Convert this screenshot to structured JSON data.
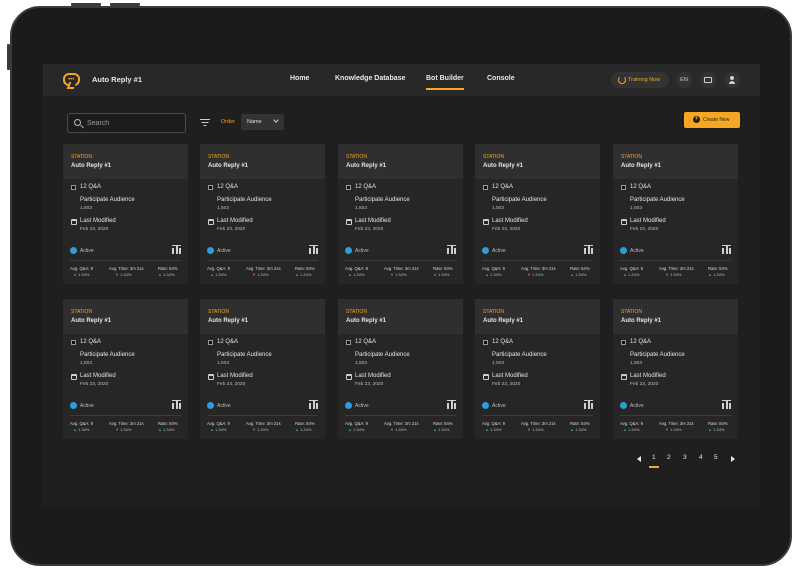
{
  "app": {
    "title": "Auto Reply #1"
  },
  "nav": [
    {
      "label": "Home",
      "active": false
    },
    {
      "label": "Knowledge Database",
      "active": false
    },
    {
      "label": "Bot Builder",
      "active": true
    },
    {
      "label": "Console",
      "active": false
    }
  ],
  "header": {
    "training_label": "Training Now",
    "language": "EN"
  },
  "toolbar": {
    "search_placeholder": "Search",
    "order_label": "Order",
    "order_value": "Name",
    "create_label": "Create New"
  },
  "card_template": {
    "tag": "STATION",
    "name": "Auto Reply #1",
    "qa": "12 Q&A",
    "audience_label": "Participate Audience",
    "audience_value": "1,503",
    "modified_label": "Last Modified",
    "modified_value": "Feb 23, 2020",
    "status": "Active",
    "stats": [
      {
        "label": "Avg. Q&A: 9",
        "trend": "up",
        "change": "1.34%"
      },
      {
        "label": "Avg. Time: 3m 21s",
        "trend": "down",
        "change": "1.34%"
      },
      {
        "label": "Rate: 84%",
        "trend": "up",
        "change": "1.34%"
      }
    ]
  },
  "cards": [
    {
      "tag": "STATION",
      "name": "Auto Reply #1",
      "qa": "12 Q&A",
      "audience_label": "Participate Audience",
      "audience_value": "1,503",
      "modified_label": "Last Modified",
      "modified_value": "Feb 23, 2020",
      "status": "Active",
      "s1": "Avg. Q&A: 9",
      "s1v": "1.34%",
      "s2": "Avg. Time: 3m 21s",
      "s2v": "1.34%",
      "s3": "Rate: 84%",
      "s3v": "1.34%"
    },
    {
      "tag": "STATION",
      "name": "Auto Reply #1",
      "qa": "12 Q&A",
      "audience_label": "Participate Audience",
      "audience_value": "1,503",
      "modified_label": "Last Modified",
      "modified_value": "Feb 23, 2020",
      "status": "Active",
      "s1": "Avg. Q&A: 9",
      "s1v": "1.34%",
      "s2": "Avg. Time: 3m 21s",
      "s2v": "1.34%",
      "s3": "Rate: 84%",
      "s3v": "1.34%"
    },
    {
      "tag": "STATION",
      "name": "Auto Reply #1",
      "qa": "12 Q&A",
      "audience_label": "Participate Audience",
      "audience_value": "1,503",
      "modified_label": "Last Modified",
      "modified_value": "Feb 23, 2020",
      "status": "Active",
      "s1": "Avg. Q&A: 9",
      "s1v": "1.34%",
      "s2": "Avg. Time: 3m 21s",
      "s2v": "1.34%",
      "s3": "Rate: 84%",
      "s3v": "1.34%"
    },
    {
      "tag": "STATION",
      "name": "Auto Reply #1",
      "qa": "12 Q&A",
      "audience_label": "Participate Audience",
      "audience_value": "1,503",
      "modified_label": "Last Modified",
      "modified_value": "Feb 23, 2020",
      "status": "Active",
      "s1": "Avg. Q&A: 9",
      "s1v": "1.34%",
      "s2": "Avg. Time: 3m 21s",
      "s2v": "1.34%",
      "s3": "Rate: 84%",
      "s3v": "1.34%"
    },
    {
      "tag": "STATION",
      "name": "Auto Reply #1",
      "qa": "12 Q&A",
      "audience_label": "Participate Audience",
      "audience_value": "1,503",
      "modified_label": "Last Modified",
      "modified_value": "Feb 23, 2020",
      "status": "Active",
      "s1": "Avg. Q&A: 9",
      "s1v": "1.34%",
      "s2": "Avg. Time: 3m 21s",
      "s2v": "1.34%",
      "s3": "Rate: 84%",
      "s3v": "1.34%"
    },
    {
      "tag": "STATION",
      "name": "Auto Reply #1",
      "qa": "12 Q&A",
      "audience_label": "Participate Audience",
      "audience_value": "1,503",
      "modified_label": "Last Modified",
      "modified_value": "Feb 23, 2020",
      "status": "Active",
      "s1": "Avg. Q&A: 9",
      "s1v": "1.34%",
      "s2": "Avg. Time: 3m 21s",
      "s2v": "1.34%",
      "s3": "Rate: 84%",
      "s3v": "1.34%"
    },
    {
      "tag": "STATION",
      "name": "Auto Reply #1",
      "qa": "12 Q&A",
      "audience_label": "Participate Audience",
      "audience_value": "1,503",
      "modified_label": "Last Modified",
      "modified_value": "Feb 23, 2020",
      "status": "Active",
      "s1": "Avg. Q&A: 9",
      "s1v": "1.34%",
      "s2": "Avg. Time: 3m 21s",
      "s2v": "1.34%",
      "s3": "Rate: 84%",
      "s3v": "1.34%"
    },
    {
      "tag": "STATION",
      "name": "Auto Reply #1",
      "qa": "12 Q&A",
      "audience_label": "Participate Audience",
      "audience_value": "1,503",
      "modified_label": "Last Modified",
      "modified_value": "Feb 23, 2020",
      "status": "Active",
      "s1": "Avg. Q&A: 9",
      "s1v": "1.34%",
      "s2": "Avg. Time: 3m 21s",
      "s2v": "1.34%",
      "s3": "Rate: 84%",
      "s3v": "1.34%"
    },
    {
      "tag": "STATION",
      "name": "Auto Reply #1",
      "qa": "12 Q&A",
      "audience_label": "Participate Audience",
      "audience_value": "1,503",
      "modified_label": "Last Modified",
      "modified_value": "Feb 23, 2020",
      "status": "Active",
      "s1": "Avg. Q&A: 9",
      "s1v": "1.34%",
      "s2": "Avg. Time: 3m 21s",
      "s2v": "1.34%",
      "s3": "Rate: 84%",
      "s3v": "1.34%"
    },
    {
      "tag": "STATION",
      "name": "Auto Reply #1",
      "qa": "12 Q&A",
      "audience_label": "Participate Audience",
      "audience_value": "1,503",
      "modified_label": "Last Modified",
      "modified_value": "Feb 23, 2020",
      "status": "Active",
      "s1": "Avg. Q&A: 9",
      "s1v": "1.34%",
      "s2": "Avg. Time: 3m 21s",
      "s2v": "1.34%",
      "s3": "Rate: 84%",
      "s3v": "1.34%"
    }
  ],
  "pagination": {
    "pages": [
      "1",
      "2",
      "3",
      "4",
      "5"
    ],
    "current": "1"
  },
  "colors": {
    "accent": "#f5a623",
    "status_active": "#2d9cdb",
    "up": "#27ae60",
    "down": "#eb5757"
  },
  "icons": [
    "logo-chat-icon",
    "training-icon",
    "chat-icon",
    "user-icon",
    "search-icon",
    "filter-icon",
    "chevron-down-icon",
    "plus-icon",
    "qa-icon",
    "calendar-icon",
    "status-dot-icon",
    "bars-chart-icon",
    "arrow-up-icon",
    "arrow-down-icon",
    "prev-page-icon",
    "next-page-icon"
  ]
}
